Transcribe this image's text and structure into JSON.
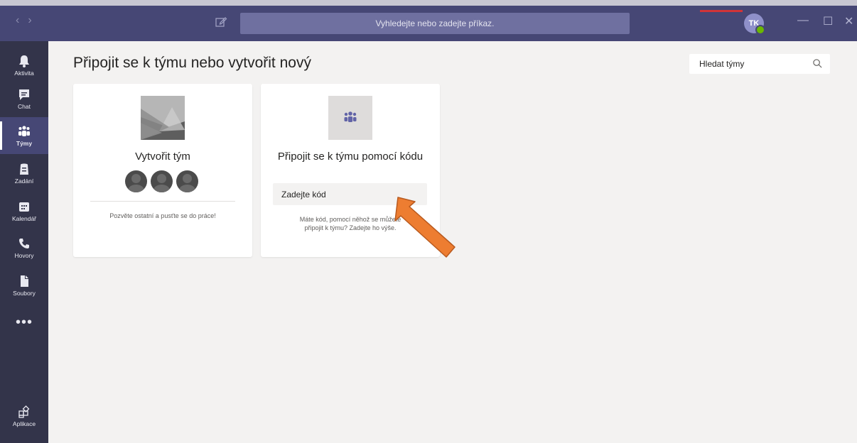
{
  "titlebar": {
    "search_placeholder": "Vyhledejte nebo zadejte příkaz.",
    "avatar_initials": "TK",
    "nav_back": "‹",
    "nav_forward": "›",
    "minimize": "—",
    "maximize": "☐",
    "close": "✕"
  },
  "rail": {
    "items": [
      {
        "label": "Aktivita",
        "icon": "bell-icon"
      },
      {
        "label": "Chat",
        "icon": "chat-icon"
      },
      {
        "label": "Týmy",
        "icon": "teams-icon",
        "active": true
      },
      {
        "label": "Zadání",
        "icon": "assignments-icon"
      },
      {
        "label": "Kalendář",
        "icon": "calendar-icon"
      },
      {
        "label": "Hovory",
        "icon": "phone-icon"
      },
      {
        "label": "Soubory",
        "icon": "files-icon"
      },
      {
        "label": "Aplikace",
        "icon": "apps-icon"
      }
    ],
    "more": "•••"
  },
  "main": {
    "title": "Připojit se k týmu nebo vytvořit nový",
    "search_teams_placeholder": "Hledat týmy"
  },
  "create_card": {
    "title": "Vytvořit tým",
    "description": "Pozvěte ostatní a pusťte se do práce!"
  },
  "join_card": {
    "title": "Připojit se k týmu pomocí kódu",
    "code_placeholder": "Zadejte kód",
    "description": "Máte kód, pomocí něhož se můžete připojit k týmu? Zadejte ho výše."
  },
  "colors": {
    "titlebar": "#464775",
    "rail": "#33344a",
    "background": "#f3f2f1",
    "arrow": "#ed7d31"
  }
}
